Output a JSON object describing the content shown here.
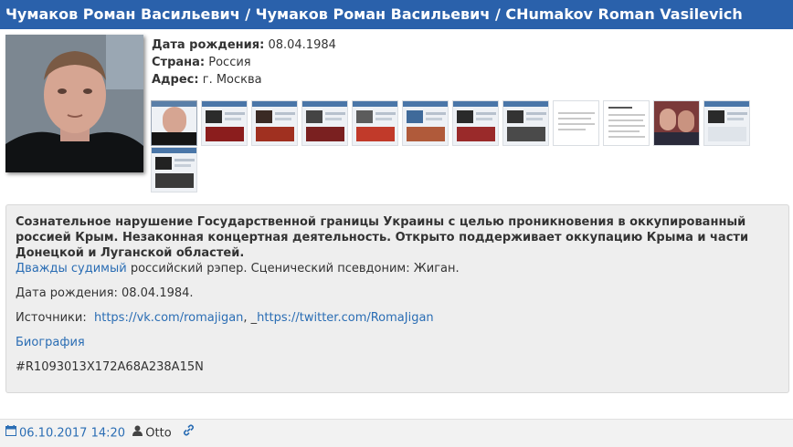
{
  "header": {
    "title": "Чумаков Роман Васильевич / Чумаков Роман Васильевич / CHumakov Roman Vasilevich"
  },
  "profile": {
    "birth_label": "Дата рождения:",
    "birth_value": "08.04.1984",
    "country_label": "Страна:",
    "country_value": "Россия",
    "address_label": "Адрес:",
    "address_value": "г. Москва"
  },
  "thumbnails_count_shown": 13,
  "description": {
    "bold_text": "Сознательное нарушение Государственной границы Украины с целью проникновения в оккупированный россией Крым. Незаконная концертная деятельность. Открыто поддерживает оккупацию Крыма и части Донецкой и Луганской областей.",
    "convicted_link": "Дважды судимый",
    "convicted_rest": " российский рэпер. Сценический псевдоним: Жиган.",
    "birth_line": "Дата рождения: 08.04.1984.",
    "sources_label": "Источники:",
    "source_1": "https://vk.com/romajigan",
    "sources_sep": ", _",
    "source_2": "https://twitter.com/RomaJigan",
    "bio_link": "Биография",
    "record_id": "#R1093013X172A68A238A15N"
  },
  "footer": {
    "date": "06.10.2017 14:20",
    "author": "Otto",
    "icons": [
      "calendar-icon",
      "user-icon",
      "link-icon"
    ]
  },
  "colors": {
    "title_bg": "#2a61ab",
    "link": "#2a6db4",
    "card_bg": "#eeeeee"
  }
}
